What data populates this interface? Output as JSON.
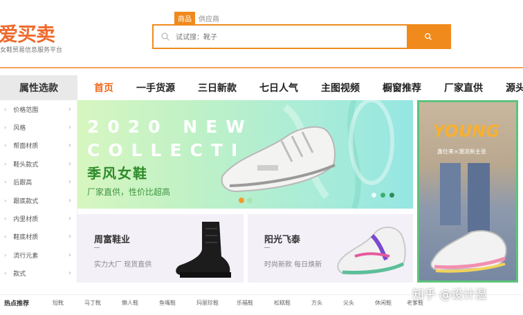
{
  "logo": {
    "name": "爱买卖",
    "subtitle": "女鞋贸易信息服务平台"
  },
  "search": {
    "tabs": [
      {
        "label": "商品",
        "active": true
      },
      {
        "label": "供应商",
        "active": false
      }
    ],
    "placeholder": "试试搜：靴子",
    "accent": "#f08a1c"
  },
  "nav": {
    "attr_title": "属性选款",
    "items": [
      {
        "label": "首页",
        "active": true
      },
      {
        "label": "一手货源"
      },
      {
        "label": "三日新款"
      },
      {
        "label": "七日人气"
      },
      {
        "label": "主图视频"
      },
      {
        "label": "橱窗推荐"
      },
      {
        "label": "厂家直供"
      },
      {
        "label": "源头厂"
      }
    ]
  },
  "sidebar": {
    "items": [
      {
        "label": "价格范围"
      },
      {
        "label": "风格"
      },
      {
        "label": "帮面材质"
      },
      {
        "label": "鞋头款式"
      },
      {
        "label": "后跟高"
      },
      {
        "label": "跟底款式"
      },
      {
        "label": "内里材质"
      },
      {
        "label": "鞋底材质"
      },
      {
        "label": "流行元素"
      },
      {
        "label": "款式"
      }
    ]
  },
  "banner": {
    "line1": "2020 NEW",
    "line2": "COLLECTI",
    "season": "季风女鞋",
    "slogan": "厂家直供，性价比超高"
  },
  "promos": [
    {
      "title": "周富鞋业",
      "desc": "实力大厂 现货直供"
    },
    {
      "title": "阳光飞泰",
      "desc": "时尚新款 每日焕新"
    }
  ],
  "side_ad": {
    "headline": "YOUNG",
    "subline": "鑫仕来×潮流新主张"
  },
  "hot": {
    "label": "热点推荐",
    "items": [
      "短靴",
      "马丁靴",
      "懒人鞋",
      "鱼嘴鞋",
      "玛丽珍鞋",
      "乐福鞋",
      "松糕鞋",
      "方头",
      "尖头",
      "休闲鞋",
      "老爹鞋"
    ]
  },
  "watermark": "知乎 @设计湿"
}
